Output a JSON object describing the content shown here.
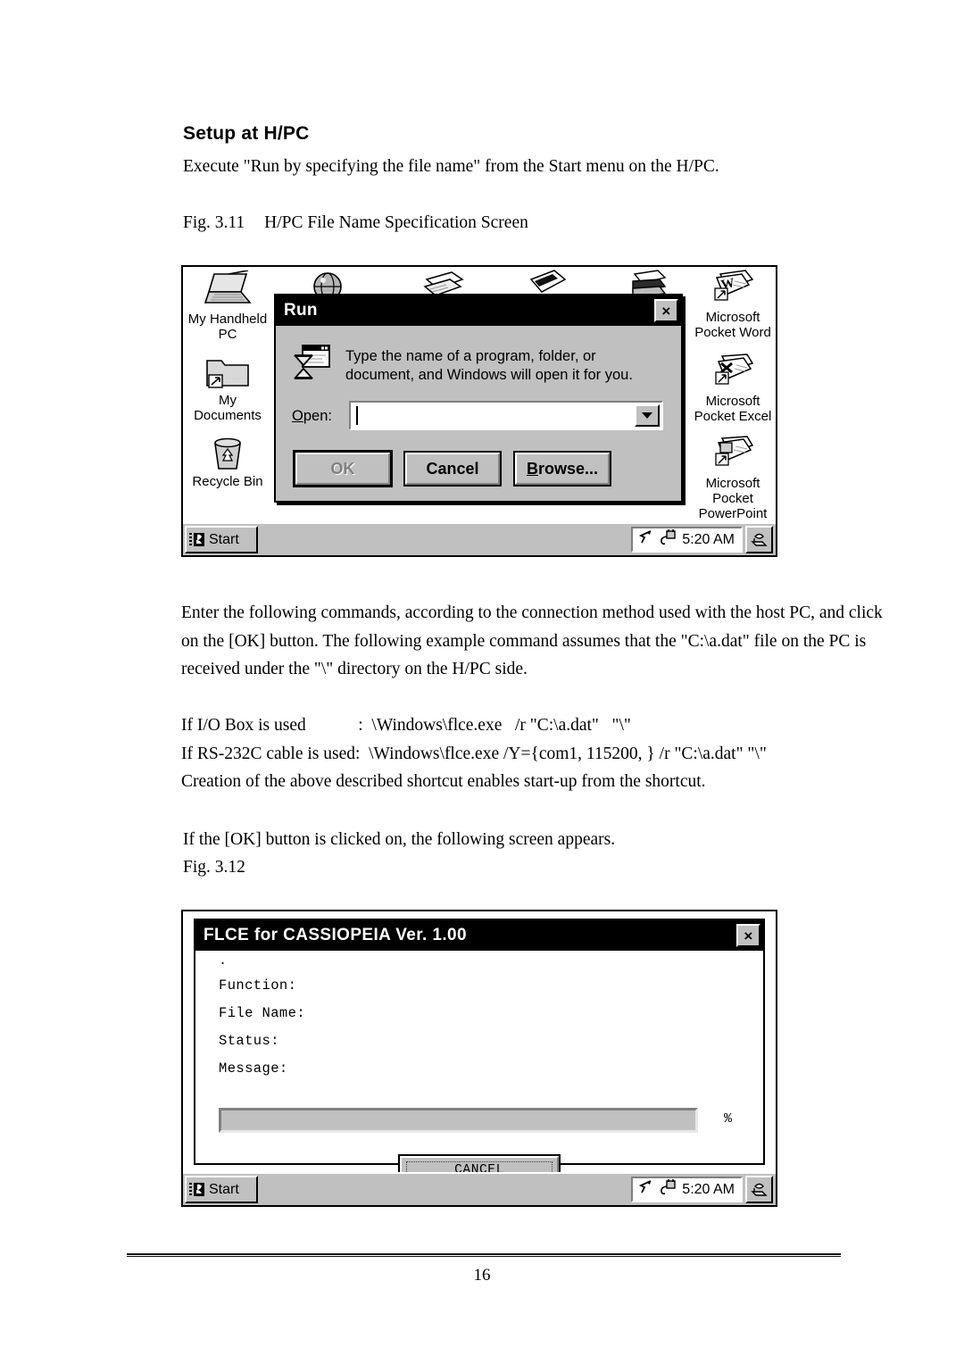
{
  "document": {
    "heading": "Setup at H/PC",
    "intro": "Execute \"Run by specifying the file name\" from the Start menu on the H/PC.",
    "fig311_label": "Fig. 3.11",
    "fig311_caption": "H/PC File Name Specification Screen",
    "body_line1": "Enter the following commands, according to the connection method used with the host PC, and click",
    "body_line2": "on the [OK] button. The following example command assumes that the \"C:\\a.dat\" file on the PC is",
    "body_line3": "received under the \"\\\" directory on the H/PC side.",
    "cmd_io_box": "If I/O Box is used            :  \\Windows\\flce.exe   /r \"C:\\a.dat\"   \"\\\"",
    "cmd_rs232c": "If RS-232C cable is used:  \\Windows\\flce.exe /Y={com1, 115200, } /r \"C:\\a.dat\" \"\\\"",
    "cmd_note": "Creation of the above described shortcut enables start-up from the shortcut.",
    "ok_note": "If the [OK] button is clicked on, the following screen appears.",
    "fig312_label": "Fig. 3.12",
    "page_number": "16"
  },
  "hpc_desktop": {
    "icons_left": [
      {
        "name": "my-handheld-pc",
        "label": "My Handheld\nPC",
        "icon": "laptop-icon"
      },
      {
        "name": "my-documents",
        "label": "My\nDocuments",
        "icon": "folder-shortcut-icon"
      },
      {
        "name": "recycle-bin",
        "label": "Recycle Bin",
        "icon": "recycle-bin-icon"
      }
    ],
    "icons_right": [
      {
        "name": "pocket-word",
        "label": "Microsoft\nPocket Word",
        "icon": "word-document-icon"
      },
      {
        "name": "pocket-excel",
        "label": "Microsoft\nPocket Excel",
        "icon": "excel-document-icon"
      },
      {
        "name": "pocket-powerpoint",
        "label": "Microsoft\nPocket\nPowerPoint",
        "icon": "powerpoint-document-icon"
      }
    ],
    "icons_top_row": [
      {
        "name": "internet-explorer",
        "icon": "globe-icon"
      },
      {
        "name": "contacts",
        "icon": "card-file-icon"
      },
      {
        "name": "notes",
        "icon": "document-icon"
      },
      {
        "name": "inbox",
        "icon": "inbox-icon"
      }
    ],
    "taskbar": {
      "start_label": "Start",
      "tray_time": "5:20 AM",
      "tray_icons": [
        "cursor-icon",
        "power-plug-icon"
      ],
      "tray_button_icon": "show-desktop-icon"
    }
  },
  "run_dialog": {
    "title": "Run",
    "close_glyph": "×",
    "icon": "run-window-hourglass-icon",
    "message": "Type the name of a program, folder, or\ndocument, and Windows will open it for you.",
    "open_label_prefix": "",
    "open_label_accel": "O",
    "open_label_suffix": "pen:",
    "open_value": "",
    "open_placeholder": "",
    "dropdown_icon": "chevron-down-icon",
    "buttons": [
      {
        "name": "ok-button",
        "label": "OK",
        "state": "disabled-default"
      },
      {
        "name": "cancel-button",
        "label": "Cancel",
        "state": "normal"
      },
      {
        "name": "browse-button",
        "label": "Browse...",
        "accel": "B",
        "state": "normal"
      }
    ]
  },
  "flce_dialog": {
    "title": "FLCE for CASSIOPEIA  Ver. 1.00",
    "close_glyph": "×",
    "leading_dot": ".",
    "fields": [
      {
        "name": "function-field",
        "label": "Function:",
        "value": ""
      },
      {
        "name": "file-name-field",
        "label": "File Name:",
        "value": ""
      },
      {
        "name": "status-field",
        "label": "Status:",
        "value": ""
      },
      {
        "name": "message-field",
        "label": "Message:",
        "value": ""
      }
    ],
    "progress_percent_symbol": "%",
    "progress_value": 0,
    "cancel_label": "CANCEL",
    "taskbar": {
      "start_label": "Start",
      "tray_time": "5:20 AM"
    }
  }
}
